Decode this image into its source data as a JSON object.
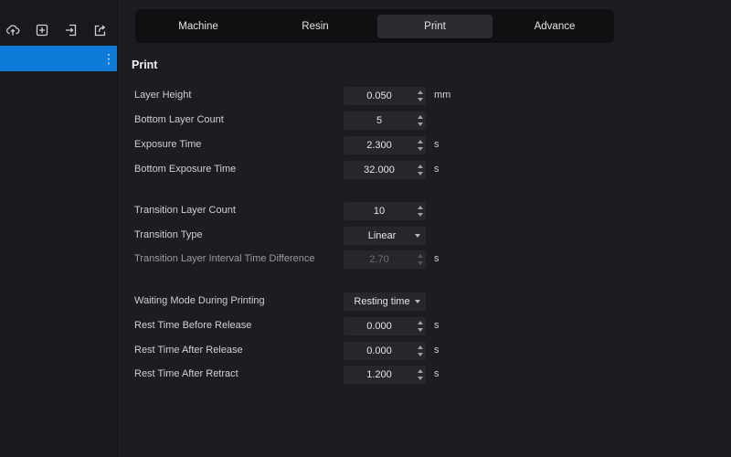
{
  "tabs": [
    {
      "label": "Machine",
      "active": false
    },
    {
      "label": "Resin",
      "active": false
    },
    {
      "label": "Print",
      "active": true
    },
    {
      "label": "Advance",
      "active": false
    }
  ],
  "toolbar": {
    "icons": [
      "cloud-upload-icon",
      "add-profile-icon",
      "import-icon",
      "export-icon"
    ]
  },
  "profile_selected": true,
  "section": {
    "title": "Print"
  },
  "fields": {
    "layer_height": {
      "label": "Layer Height",
      "value": "0.050",
      "unit": "mm"
    },
    "bottom_layer_count": {
      "label": "Bottom Layer Count",
      "value": "5",
      "unit": ""
    },
    "exposure_time": {
      "label": "Exposure Time",
      "value": "2.300",
      "unit": "s"
    },
    "bottom_exposure_time": {
      "label": "Bottom Exposure Time",
      "value": "32.000",
      "unit": "s"
    },
    "transition_layer_count": {
      "label": "Transition Layer Count",
      "value": "10",
      "unit": ""
    },
    "transition_type": {
      "label": "Transition Type",
      "value": "Linear"
    },
    "transition_interval": {
      "label": "Transition Layer Interval Time Difference",
      "value": "2.70",
      "unit": "s",
      "disabled": true
    },
    "waiting_mode": {
      "label": "Waiting Mode During Printing",
      "value": "Resting time"
    },
    "rest_before_release": {
      "label": "Rest Time Before Release",
      "value": "0.000",
      "unit": "s"
    },
    "rest_after_release": {
      "label": "Rest Time After Release",
      "value": "0.000",
      "unit": "s"
    },
    "rest_after_retract": {
      "label": "Rest Time After Retract",
      "value": "1.200",
      "unit": "s"
    }
  },
  "colors": {
    "accent": "#0f7bd8",
    "background": "#1c1d20",
    "sidebar": "#18191c",
    "input": "#26272b"
  }
}
